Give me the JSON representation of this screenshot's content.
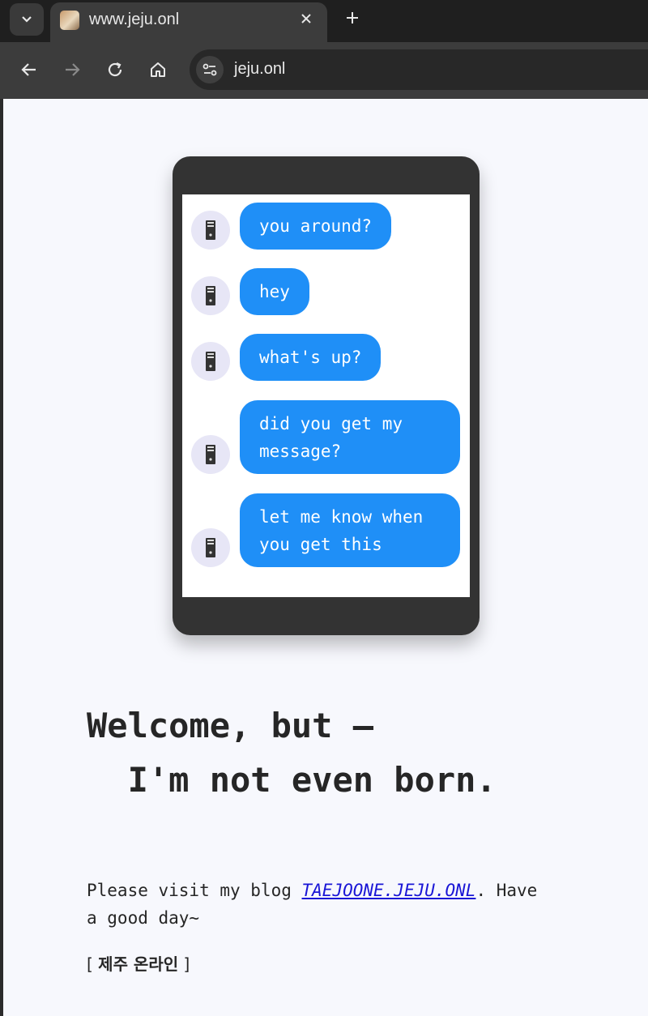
{
  "browser": {
    "tab_title": "www.jeju.onl",
    "url": "jeju.onl"
  },
  "chat": {
    "messages": [
      {
        "text": "you around?"
      },
      {
        "text": "hey"
      },
      {
        "text": "what's up?"
      },
      {
        "text": "did you get my message?"
      },
      {
        "text": "let me know when you get this"
      }
    ]
  },
  "headline": {
    "line1": "Welcome, but —",
    "line2": "I'm not even born."
  },
  "blog": {
    "prefix": "Please visit my blog ",
    "link_text": "TAEJOONE.JEJU.ONL",
    "suffix": ". Have a good day~"
  },
  "footer": {
    "bracket_open": "[ ",
    "label": "제주 온라인",
    "bracket_close": " ]"
  },
  "colors": {
    "bubble": "#1f8ff7",
    "avatar_bg": "#e7e6f6",
    "phone_frame": "#333333",
    "link": "#1a16d6"
  }
}
